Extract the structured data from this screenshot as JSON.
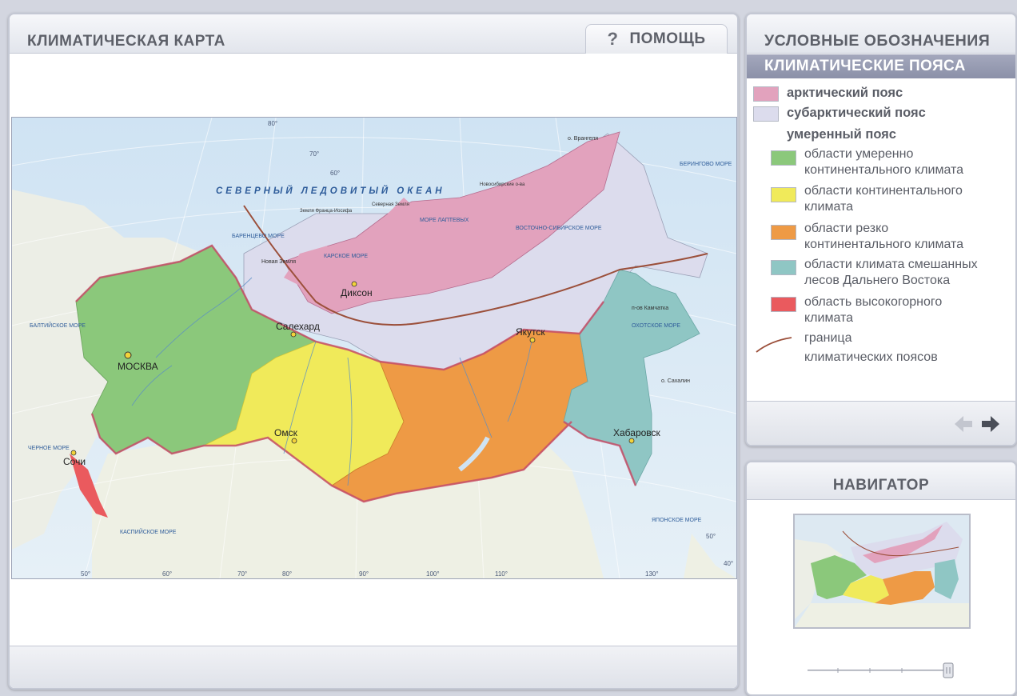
{
  "main": {
    "title": "КЛИМАТИЧЕСКАЯ КАРТА",
    "help_label": "ПОМОЩЬ",
    "help_icon": "question-icon"
  },
  "map": {
    "ocean_label": "СЕВЕРНЫЙ ЛЕДОВИТЫЙ ОКЕАН",
    "seas": [
      "БАРЕНЦЕВО МОРЕ",
      "КАРСКОЕ МОРЕ",
      "МОРЕ ЛАПТЕВЫХ",
      "ВОСТОЧНО-СИБИРСКОЕ МОРЕ",
      "ОХОТСКОЕ МОРЕ",
      "ЧЕРНОЕ МОРЕ",
      "КАСПИЙСКОЕ МОРЕ",
      "ЯПОНСКОЕ МОРЕ",
      "БАЛТИЙСКОЕ МОРЕ",
      "БЕРИНГОВО МОРЕ"
    ],
    "islands": [
      "о. Врангеля",
      "о. Сахалин",
      "Новая Земля",
      "Северная Земля",
      "Новосибирские о-ва",
      "Земля Франца-Иосифа"
    ],
    "cities": [
      {
        "name": "МОСКВА",
        "capital": true
      },
      {
        "name": "Салехард",
        "capital": false
      },
      {
        "name": "Диксон",
        "capital": false
      },
      {
        "name": "Якутск",
        "capital": false
      },
      {
        "name": "Омск",
        "capital": false
      },
      {
        "name": "Хабаровск",
        "capital": false
      },
      {
        "name": "Сочи",
        "capital": false
      }
    ],
    "peninsula": "п-ов Камчатка",
    "lat_labels": [
      "80°",
      "70°",
      "60°",
      "50°",
      "40°"
    ],
    "lon_labels": [
      "50°",
      "60°",
      "70°",
      "80°",
      "90°",
      "100°",
      "110°",
      "130°"
    ]
  },
  "legend": {
    "title": "УСЛОВНЫЕ ОБОЗНАЧЕНИЯ",
    "section": "КЛИМАТИЧЕСКИЕ ПОЯСА",
    "items": [
      {
        "label": "арктический пояс",
        "color": "#e2a2bd"
      },
      {
        "label": "субарктический пояс",
        "color": "#dcdced"
      },
      {
        "label": "умеренный пояс"
      },
      {
        "line1": "области умеренно",
        "line2": "континентального климата",
        "color": "#8bc87b"
      },
      {
        "line1": "области континентального",
        "line2": "климата",
        "color": "#f0ea5a"
      },
      {
        "line1": "области резко",
        "line2": "континентального климата",
        "color": "#ee9a45"
      },
      {
        "line1": "области климата смешанных",
        "line2": "лесов Дальнего Востока",
        "color": "#8fc6c4"
      },
      {
        "line1": "область высокогорного",
        "line2": "климата",
        "color": "#ea5a5e"
      },
      {
        "line1": "граница",
        "line2": "климатических поясов",
        "color": "#9b4f3a"
      }
    ],
    "prev_icon": "arrow-left-icon",
    "next_icon": "arrow-right-icon"
  },
  "navigator": {
    "title": "НАВИГАТОР",
    "zoom_icon": "zoom-slider-icon"
  },
  "colors": {
    "arctic": "#e2a2bd",
    "subarctic": "#dcdced",
    "temperate_continental_moderate": "#8bc87b",
    "continental": "#f0ea5a",
    "sharply_continental": "#ee9a45",
    "far_east": "#8fc6c4",
    "highland": "#ea5a5e",
    "border": "#9b4f3a",
    "water": "#d7e9f6"
  }
}
